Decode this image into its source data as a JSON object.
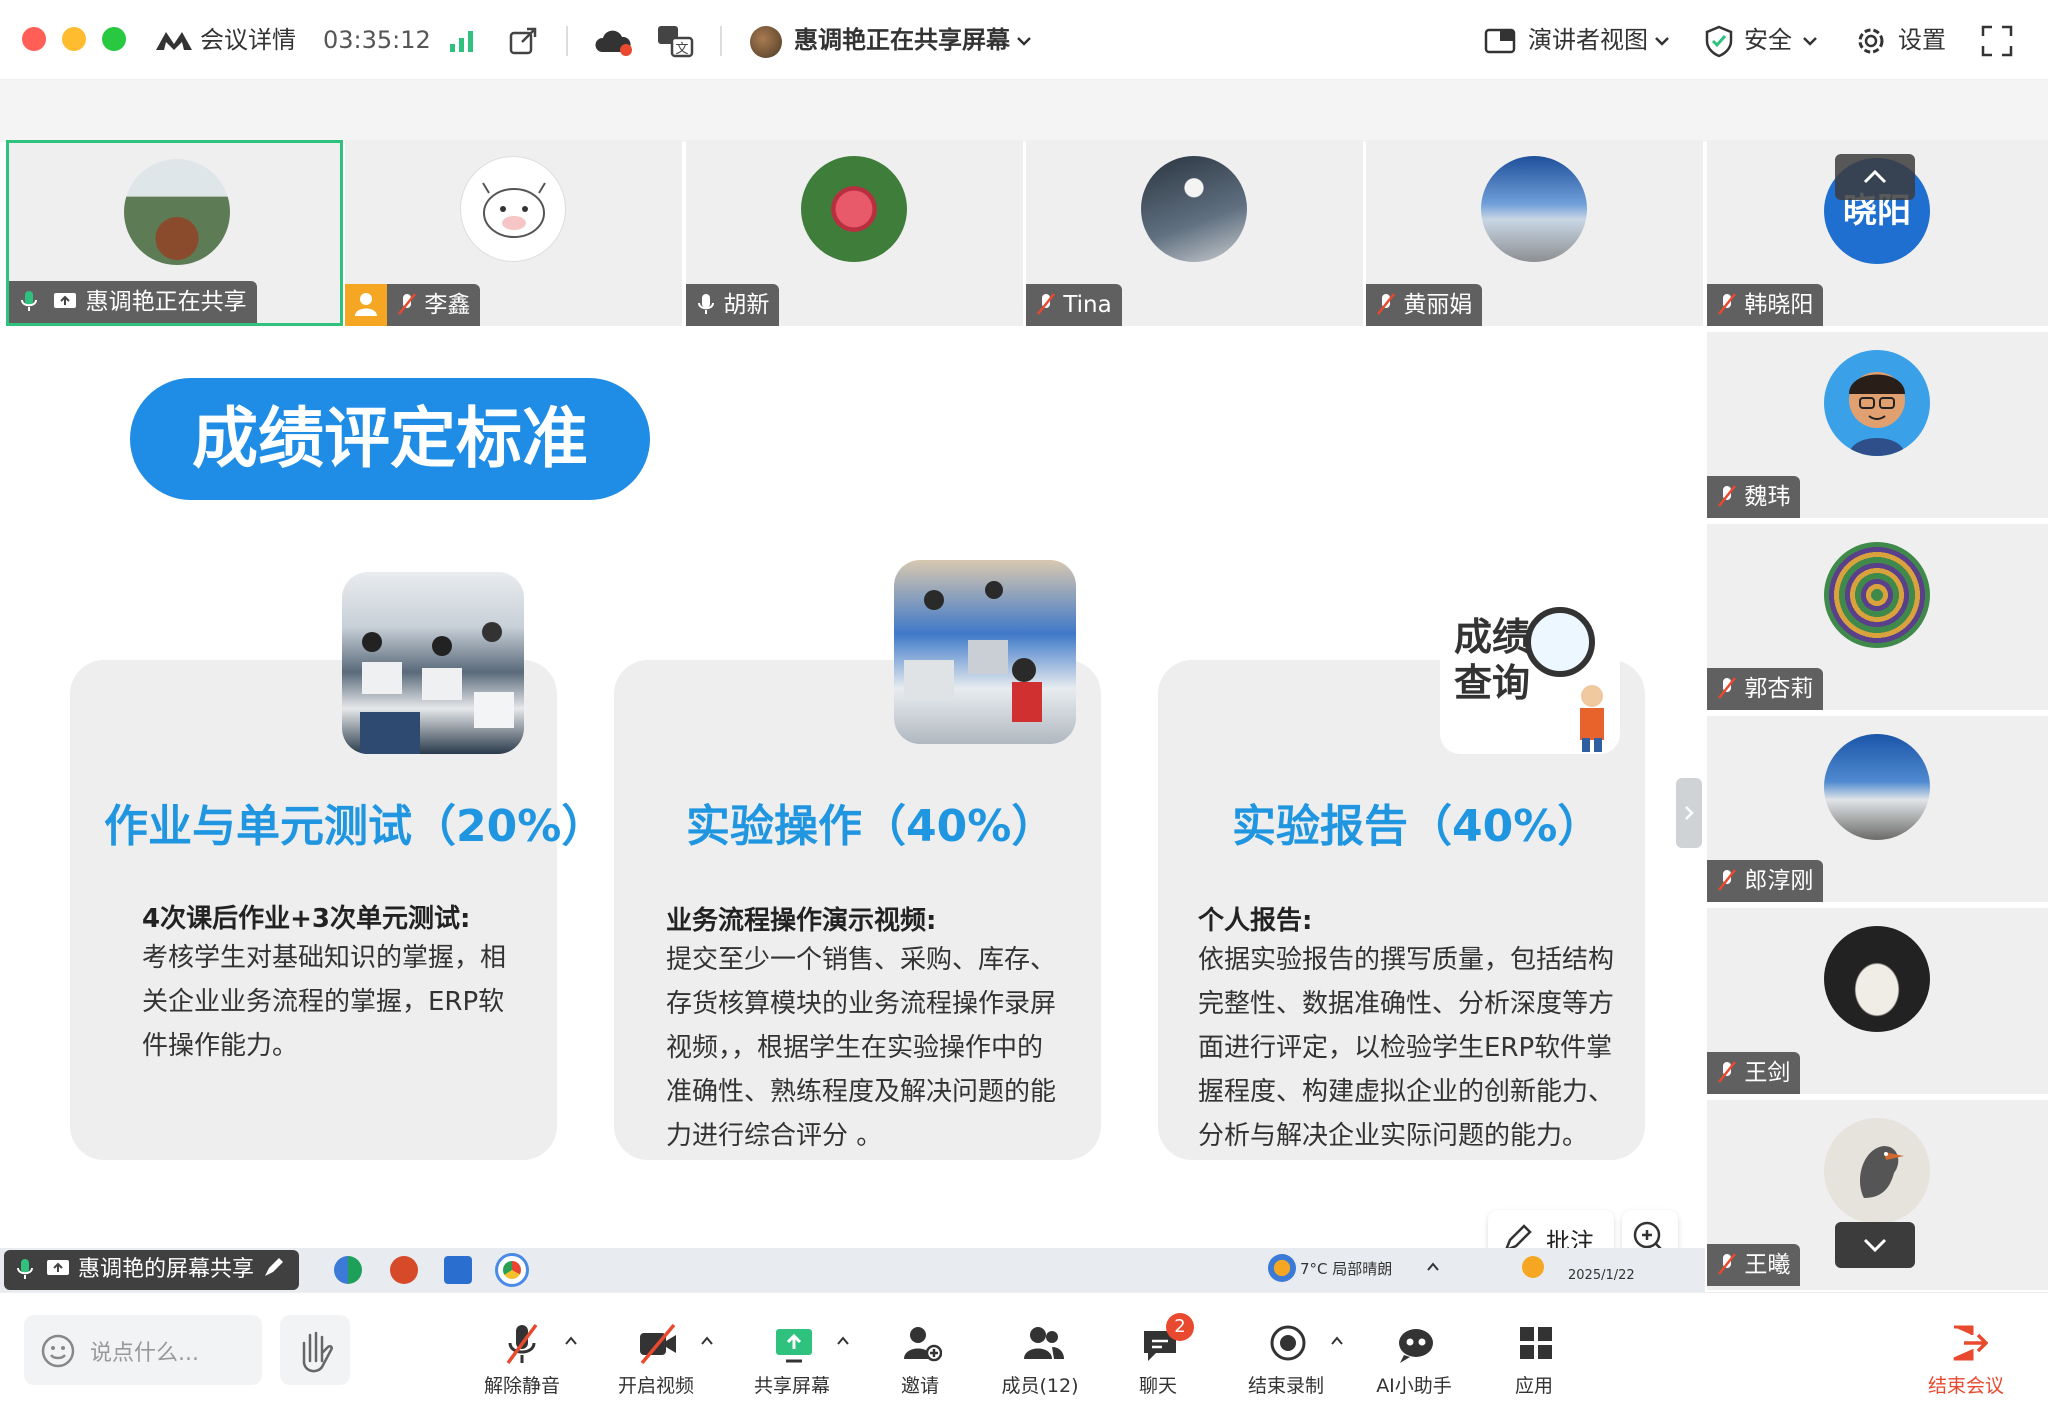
{
  "topbar": {
    "meeting_details": "会议详情",
    "timer": "03:35:12",
    "sharing_status": "惠调艳正在共享屏幕",
    "presenter_view": "演讲者视图",
    "security": "安全",
    "settings": "设置"
  },
  "gallery": [
    {
      "name": "惠调艳正在共享"
    },
    {
      "name": "李鑫"
    },
    {
      "name": "胡新"
    },
    {
      "name": "Tina"
    },
    {
      "name": "黄丽娟"
    }
  ],
  "sidebar": [
    {
      "name": "韩晓阳",
      "avatar_text": "晓阳"
    },
    {
      "name": "魏玮"
    },
    {
      "name": "郭杏莉"
    },
    {
      "name": "郎淳刚"
    },
    {
      "name": "王剑"
    },
    {
      "name": "王曦"
    }
  ],
  "slide": {
    "banner": "成绩评定标准",
    "cards": [
      {
        "title": "作业与单元测试（20%）",
        "subtitle": "4次课后作业+3次单元测试:",
        "lines": [
          "考核学生对基础知识的掌握，相",
          "关企业业务流程的掌握，ERP软",
          "件操作能力。"
        ]
      },
      {
        "title": "实验操作（40%）",
        "subtitle": "业务流程操作演示视频:",
        "lines": [
          "提交至少一个销售、采购、库存、",
          "存货核算模块的业务流程操作录屏",
          "视频，，根据学生在实验操作中的",
          "准确性、熟练程度及解决问题的能",
          "力进行综合评分 。"
        ]
      },
      {
        "title": "实验报告（40%）",
        "subtitle": "个人报告:",
        "lines": [
          "依据实验报告的撰写质量，包括结构",
          "完整性、数据准确性、分析深度等方",
          "面进行评定，以检验学生ERP软件掌",
          "握程度、构建虚拟企业的创新能力、",
          "分析与解决企业实际问题的能力。"
        ]
      }
    ],
    "card3_image_text": [
      "成绩",
      "查询"
    ]
  },
  "taskbar": {
    "share_label": "惠调艳的屏幕共享",
    "weather": "7°C 局部晴朗",
    "date": "2025/1/22"
  },
  "annotate": {
    "label": "批注"
  },
  "bottombar": {
    "chat_placeholder": "说点什么...",
    "unmute": "解除静音",
    "start_video": "开启视频",
    "share_screen": "共享屏幕",
    "invite": "邀请",
    "members": "成员(12)",
    "chat": "聊天",
    "chat_badge": "2",
    "stop_recording": "结束录制",
    "ai_assistant": "AI小助手",
    "apps": "应用",
    "end_meeting": "结束会议"
  },
  "colors": {
    "accent_blue": "#2196e0",
    "end_red": "#e8492f",
    "active_green": "#2ec27e"
  }
}
